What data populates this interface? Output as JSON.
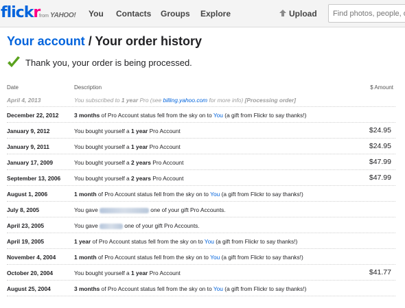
{
  "topbar": {
    "logo_flick": "flick",
    "logo_r": "r",
    "from": "from",
    "yahoo": "YAHOO!",
    "nav": [
      "You",
      "Contacts",
      "Groups",
      "Explore"
    ],
    "upload": "Upload",
    "search_placeholder": "Find photos, people, or g"
  },
  "heading": {
    "link": "Your account",
    "sep": " / ",
    "rest": "Your order history"
  },
  "confirmation": "Thank you, your order is being processed.",
  "table": {
    "headers": {
      "date": "Date",
      "description": "Description",
      "amount": "$ Amount"
    },
    "pending": {
      "date": "April 4, 2013",
      "pre": "You subscribed to ",
      "bold": "1 year",
      "mid": " Pro (see ",
      "link": "billing.yahoo.com",
      "post": " for more info) ",
      "status": "[Processing order]"
    },
    "rows": [
      {
        "date": "December 22, 2012",
        "pre": "",
        "bold": "3 months",
        "mid": " of Pro Account status fell from the sky on to ",
        "link": "You",
        "post": " (a gift from Flickr to say thanks!)",
        "amount": ""
      },
      {
        "date": "January 9, 2012",
        "pre": "You bought yourself a ",
        "bold": "1 year",
        "mid": " Pro Account",
        "link": "",
        "post": "",
        "amount": "$24.95"
      },
      {
        "date": "January 9, 2011",
        "pre": "You bought yourself a ",
        "bold": "1 year",
        "mid": " Pro Account",
        "link": "",
        "post": "",
        "amount": "$24.95"
      },
      {
        "date": "January 17, 2009",
        "pre": "You bought yourself a ",
        "bold": "2 years",
        "mid": " Pro Account",
        "link": "",
        "post": "",
        "amount": "$47.99"
      },
      {
        "date": "September 13, 2006",
        "pre": "You bought yourself a ",
        "bold": "2 years",
        "mid": " Pro Account",
        "link": "",
        "post": "",
        "amount": "$47.99"
      },
      {
        "date": "August 1, 2006",
        "pre": "",
        "bold": "1 month",
        "mid": " of Pro Account status fell from the sky on to ",
        "link": "You",
        "post": " (a gift from Flickr to say thanks!)",
        "amount": ""
      },
      {
        "date": "July 8, 2005",
        "pre": "You gave ",
        "bold": "",
        "mid": "",
        "link": "",
        "post": " one of your gift Pro Accounts.",
        "amount": "",
        "blur": 72
      },
      {
        "date": "April 23, 2005",
        "pre": "You gave ",
        "bold": "",
        "mid": "",
        "link": "",
        "post": " one of your gift Pro Accounts.",
        "amount": "",
        "blur": 34
      },
      {
        "date": "April 19, 2005",
        "pre": "",
        "bold": "1 year",
        "mid": " of Pro Account status fell from the sky on to ",
        "link": "You",
        "post": " (a gift from Flickr to say thanks!)",
        "amount": ""
      },
      {
        "date": "November 4, 2004",
        "pre": "",
        "bold": "1 month",
        "mid": " of Pro Account status fell from the sky on to ",
        "link": "You",
        "post": " (a gift from Flickr to say thanks!)",
        "amount": ""
      },
      {
        "date": "October 20, 2004",
        "pre": "You bought yourself a ",
        "bold": "1 year",
        "mid": " Pro Account",
        "link": "",
        "post": "",
        "amount": "$41.77"
      },
      {
        "date": "August 25, 2004",
        "pre": "",
        "bold": "3 months",
        "mid": " of Pro Account status fell from the sky on to ",
        "link": "You",
        "post": " (a gift from Flickr to say thanks!)",
        "amount": ""
      }
    ]
  },
  "colors": {
    "brand_blue": "#0063dc",
    "brand_pink": "#ff0084",
    "check_green": "#5aa21e"
  },
  "icons": {
    "upload": "upload-arrow-icon",
    "confirm": "checkmark-icon"
  }
}
